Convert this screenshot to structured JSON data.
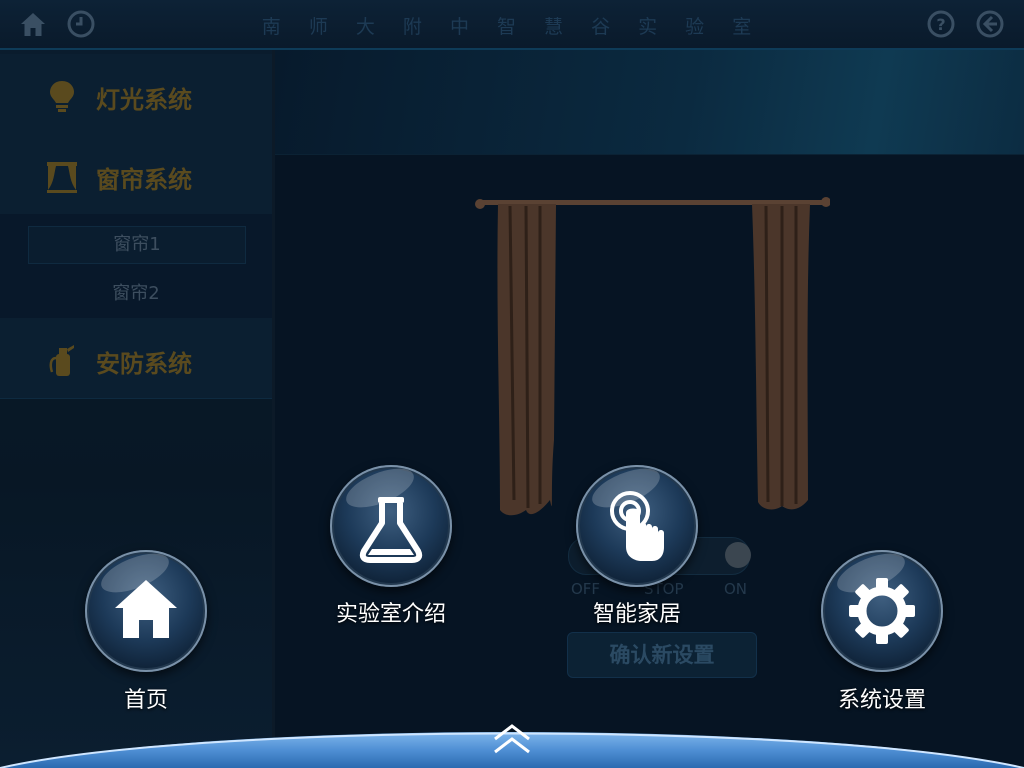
{
  "header": {
    "title": "南 师 大 附 中 智 慧 谷 实 验 室",
    "icons": [
      "home-icon",
      "clock-icon",
      "help-icon",
      "back-icon"
    ]
  },
  "sidebar": {
    "items": [
      {
        "label": "灯光系统",
        "icon": "lightbulb-icon"
      },
      {
        "label": "窗帘系统",
        "icon": "curtain-icon"
      },
      {
        "label": "安防系统",
        "icon": "fire-extinguisher-icon"
      }
    ],
    "subitems": [
      {
        "label": "窗帘1",
        "active": true
      },
      {
        "label": "窗帘2",
        "active": false
      }
    ]
  },
  "curtain_control": {
    "labels": [
      "OFF",
      "STOP",
      "ON"
    ],
    "state": "ON",
    "confirm_label": "确认新设置"
  },
  "dock_menu": {
    "buttons": [
      {
        "label": "首页",
        "icon": "home-icon"
      },
      {
        "label": "实验室介绍",
        "icon": "flask-icon"
      },
      {
        "label": "智能家居",
        "icon": "touch-hand-icon"
      },
      {
        "label": "系统设置",
        "icon": "gear-icon"
      }
    ],
    "toggle_icon": "double-chevron-up-icon"
  },
  "colors": {
    "background": "#071626",
    "menu_label": "#5a4a1e",
    "dock_blue": "#4f8fd4"
  }
}
